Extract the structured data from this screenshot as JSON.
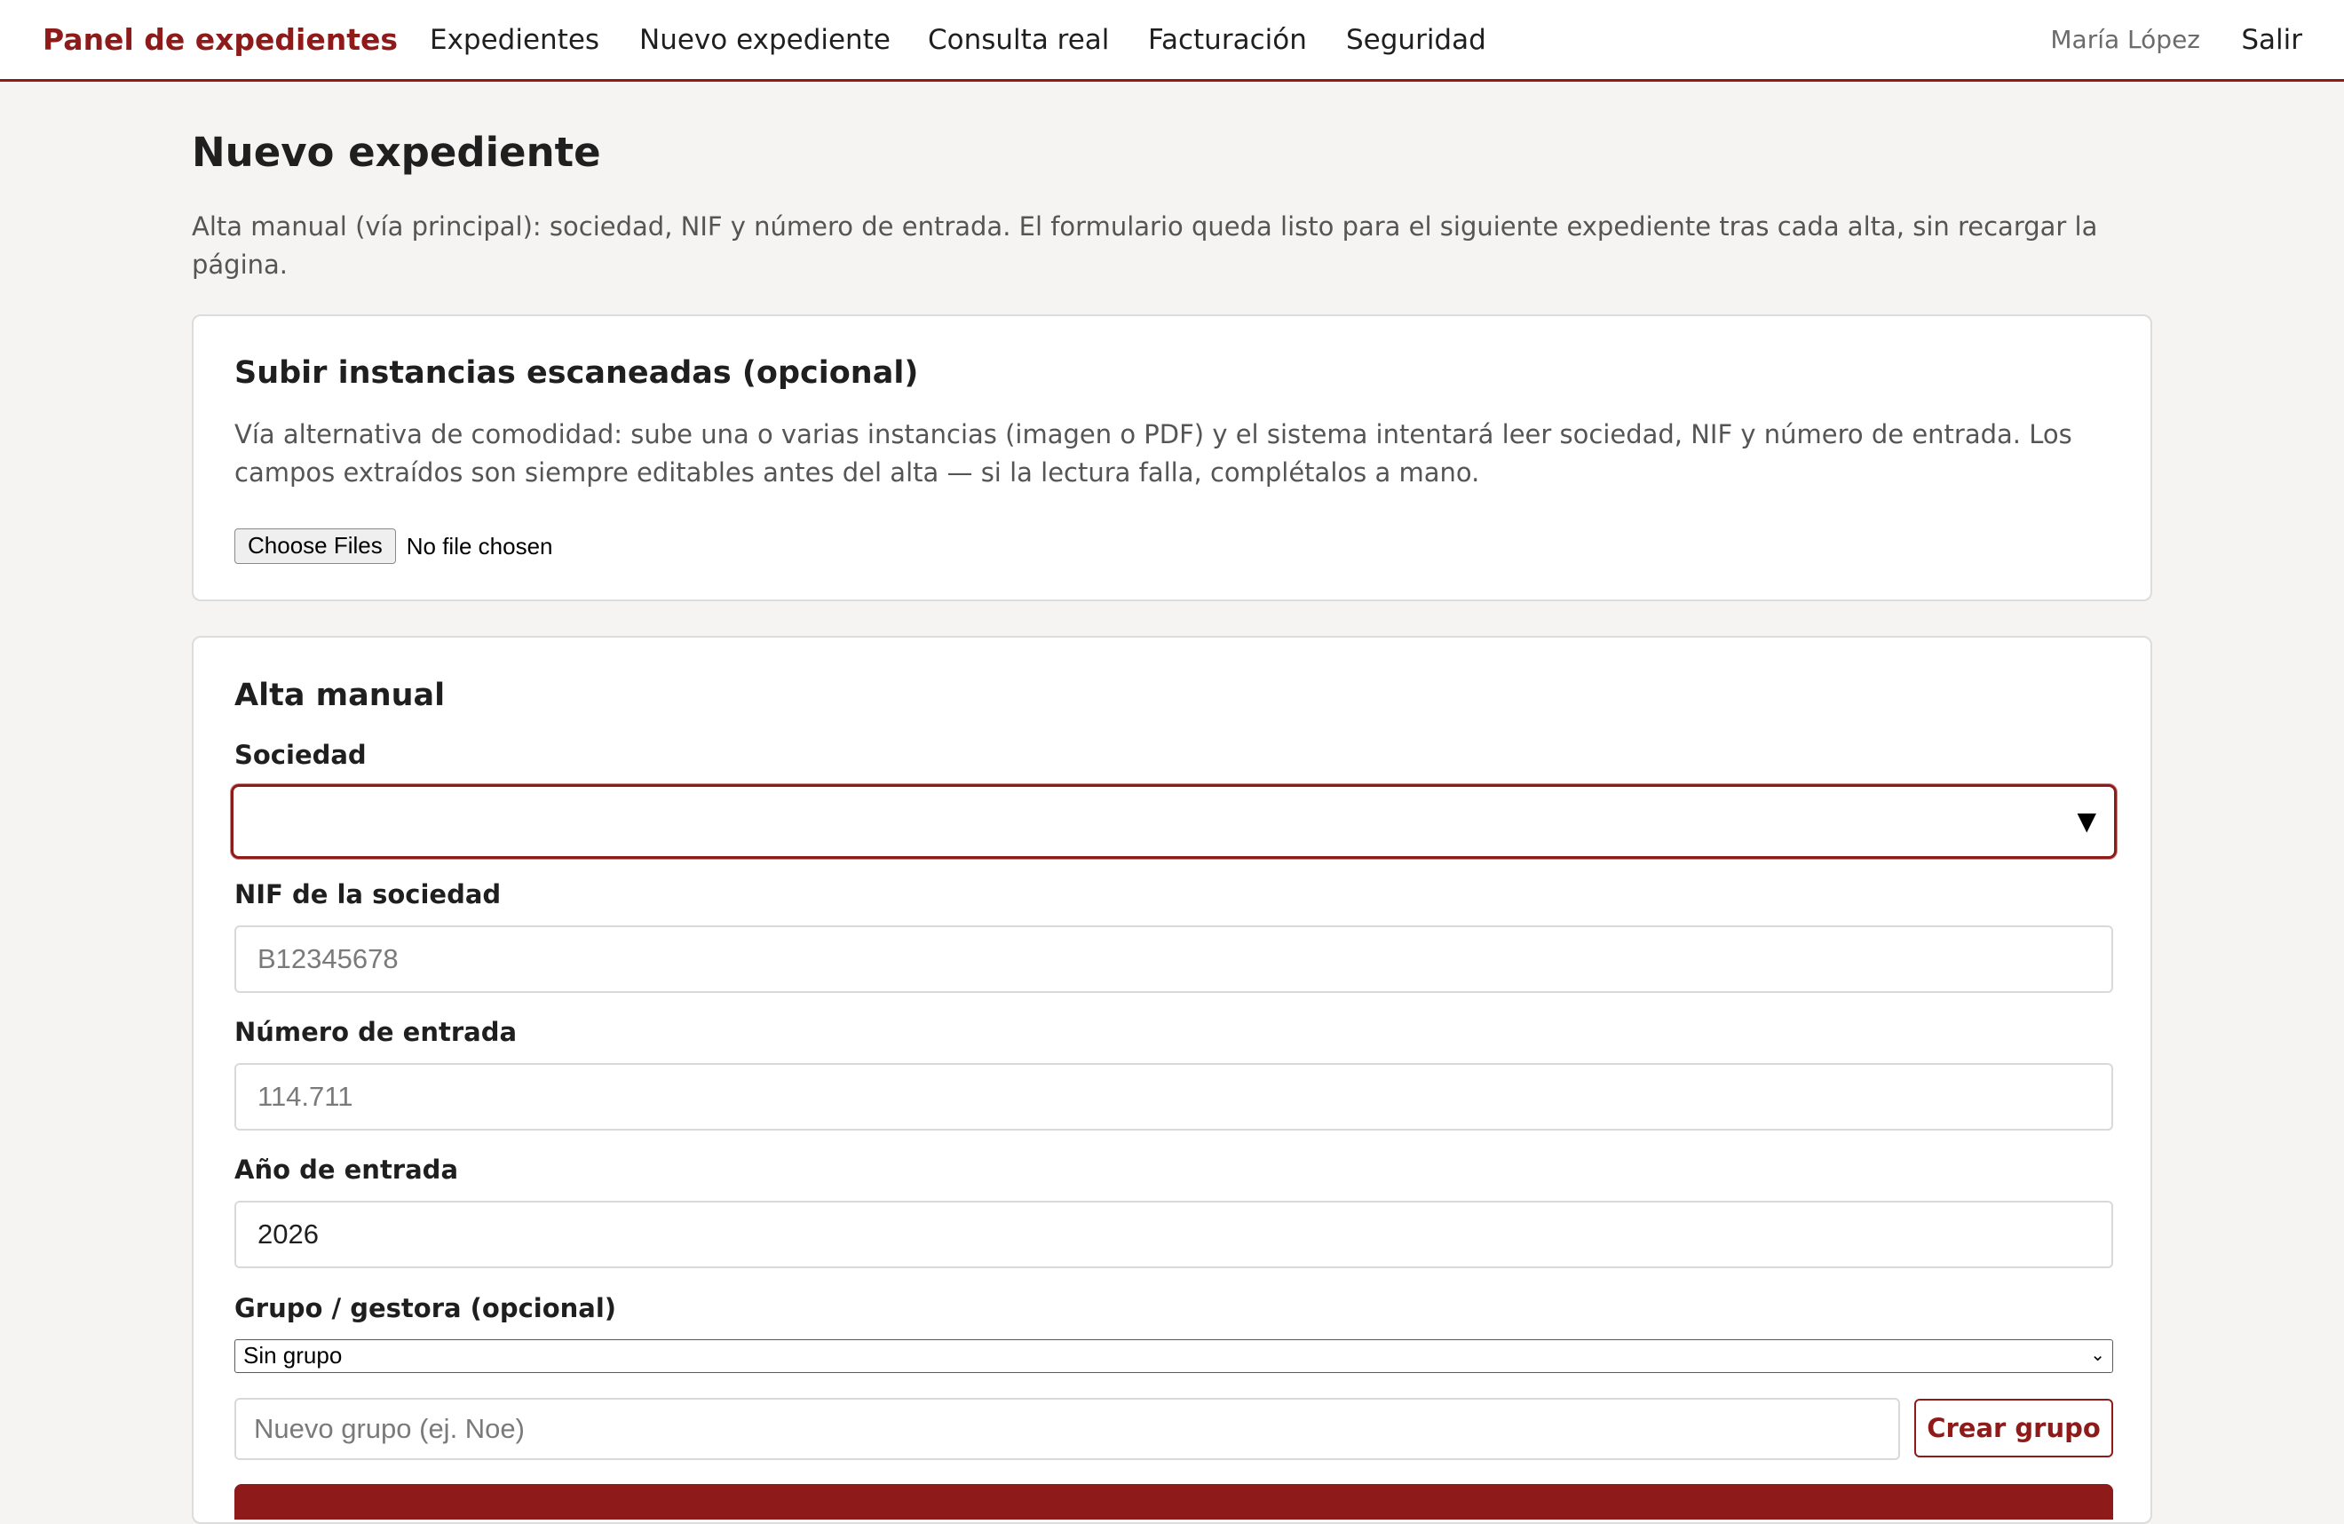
{
  "nav": {
    "brand": "Panel de expedientes",
    "links": [
      "Expedientes",
      "Nuevo expediente",
      "Consulta real",
      "Facturación",
      "Seguridad"
    ],
    "user": "María López",
    "logout": "Salir"
  },
  "page": {
    "title": "Nuevo expediente",
    "intro": "Alta manual (vía principal): sociedad, NIF y número de entrada. El formulario queda listo para el siguiente expediente tras cada alta, sin recargar la página."
  },
  "upload": {
    "title": "Subir instancias escaneadas (opcional)",
    "description": "Vía alternativa de comodidad: sube una o varias instancias (imagen o PDF) y el sistema intentará leer sociedad, NIF y número de entrada. Los campos extraídos son siempre editables antes del alta — si la lectura falla, complétalos a mano.",
    "button_label": "Choose Files",
    "status": "No file chosen"
  },
  "manual": {
    "title": "Alta manual",
    "sociedad": {
      "label": "Sociedad",
      "value": ""
    },
    "nif": {
      "label": "NIF de la sociedad",
      "placeholder": "B12345678",
      "value": ""
    },
    "numero": {
      "label": "Número de entrada",
      "placeholder": "114.711",
      "value": ""
    },
    "anio": {
      "label": "Año de entrada",
      "value": "2026"
    },
    "grupo": {
      "label": "Grupo / gestora (opcional)",
      "selected": "Sin grupo"
    },
    "nuevo_grupo": {
      "placeholder": "Nuevo grupo (ej. Noe)",
      "value": ""
    },
    "create_group_label": "Crear grupo"
  },
  "colors": {
    "accent": "#8e1a1a",
    "background": "#f5f4f2",
    "card": "#ffffff",
    "muted_text": "#555555"
  },
  "icons": {
    "select_arrow": "caret-down-icon",
    "native_select_arrow": "chevron-down-icon"
  }
}
